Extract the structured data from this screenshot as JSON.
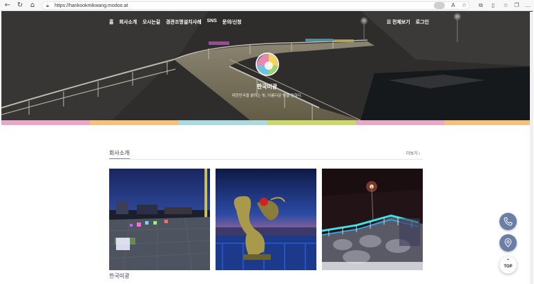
{
  "browser": {
    "url": "https://hankookmikwang.modoo.at",
    "back_icon": "arrow-left-icon",
    "reload_icon": "reload-icon",
    "home_icon": "home-icon"
  },
  "nav": {
    "items": [
      {
        "label": "홈"
      },
      {
        "label": "회사소개"
      },
      {
        "label": "오시는길"
      },
      {
        "label": "경관조명설치사례"
      },
      {
        "label": "SNS"
      },
      {
        "label": "문의/신청"
      }
    ],
    "view_all": "☰ 전체보기",
    "login": "로그인"
  },
  "hero": {
    "brand": "한국미광",
    "tagline": "대한민국을 밝히는 빛, 아름다운 빛을 전하다."
  },
  "band_colors": [
    "#e8a7c4",
    "#f5c07a",
    "#a8dbe0",
    "#c8d96a",
    "#e8a7c4",
    "#f5c07a"
  ],
  "section": {
    "title": "회사소개",
    "more": "더보기 ›",
    "caption": "한국미광"
  },
  "floating": {
    "phone_icon": "phone-icon",
    "location_icon": "location-pin-icon",
    "top_arrow": "⌃",
    "top_label": "TOP"
  }
}
